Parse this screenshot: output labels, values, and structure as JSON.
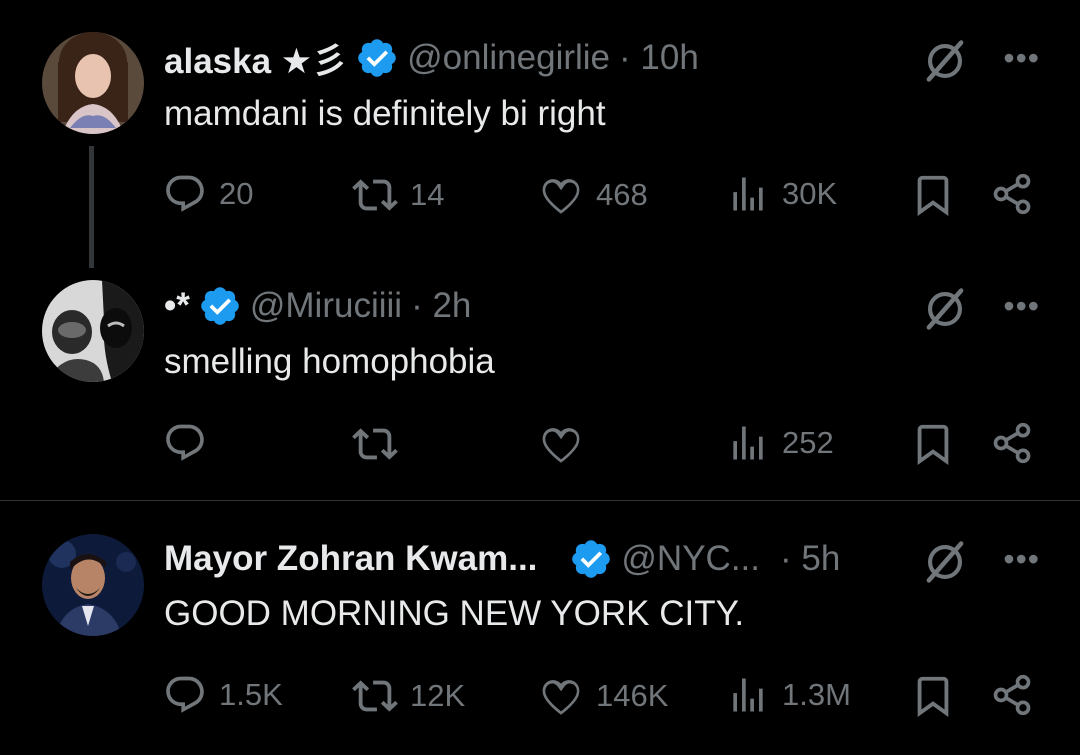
{
  "tweets": [
    {
      "name": "alaska ★彡",
      "handle": "@onlinegirlie",
      "time": "· 10h",
      "text": "mamdani is definitely bi right",
      "replies": "20",
      "reposts": "14",
      "likes": "468",
      "views": "30K"
    },
    {
      "name": "•*",
      "handle": "@Miruciiii",
      "time": "· 2h",
      "text": "smelling homophobia",
      "replies": "",
      "reposts": "",
      "likes": "",
      "views": "252"
    },
    {
      "name": "Mayor Zohran Kwam...",
      "handle": "@NYC...",
      "time": "· 5h",
      "text": "GOOD MORNING NEW YORK CITY.",
      "replies": "1.5K",
      "reposts": "12K",
      "likes": "146K",
      "views": "1.3M"
    }
  ],
  "more_label": "•••",
  "colors": {
    "background": "#000000",
    "text": "#e7e9ea",
    "muted": "#71767b",
    "verified": "#1d9bf0",
    "divider": "#2f3336"
  },
  "icons": [
    "verified-badge-icon",
    "grok-icon",
    "more-icon",
    "reply-icon",
    "repost-icon",
    "like-icon",
    "views-icon",
    "bookmark-icon",
    "share-icon"
  ]
}
